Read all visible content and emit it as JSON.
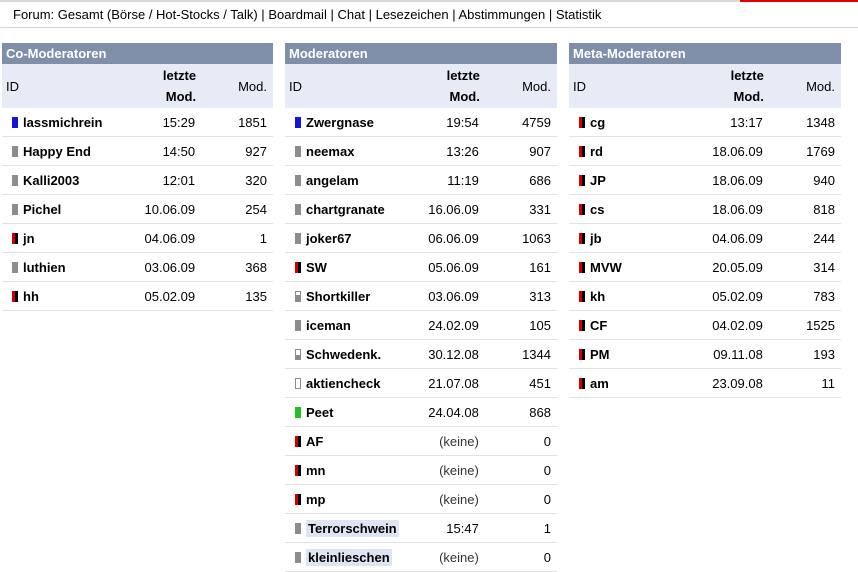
{
  "nav": {
    "prefix": "Forum:",
    "items": [
      "Gesamt (Börse / Hot-Stocks / Talk)",
      "Boardmail",
      "Chat",
      "Lesezeichen",
      "Abstimmungen",
      "Statistik"
    ],
    "separator": "|"
  },
  "colors": {
    "header_bg": "#7f8ea9",
    "subheader_bg": "#e6ebf5",
    "blue": "#1515d8",
    "grey": "#8c8c8c",
    "red": "#d00000",
    "green": "#22c022"
  },
  "panels": [
    {
      "title": "Co-Moderatoren",
      "headers": {
        "id": "ID",
        "time_line1": "letzte",
        "time_line2": "Mod.",
        "mod": "Mod."
      },
      "rows": [
        {
          "name": "lassmichrein",
          "time": "15:29",
          "mod": "1851",
          "indicator": "blue"
        },
        {
          "name": "Happy End",
          "time": "14:50",
          "mod": "927",
          "indicator": "grey"
        },
        {
          "name": "Kalli2003",
          "time": "12:01",
          "mod": "320",
          "indicator": "grey"
        },
        {
          "name": "Pichel",
          "time": "10.06.09",
          "mod": "254",
          "indicator": "grey"
        },
        {
          "name": "jn",
          "time": "04.06.09",
          "mod": "1",
          "indicator": "red-black"
        },
        {
          "name": "luthien",
          "time": "03.06.09",
          "mod": "368",
          "indicator": "grey"
        },
        {
          "name": "hh",
          "time": "05.02.09",
          "mod": "135",
          "indicator": "red-black"
        }
      ]
    },
    {
      "title": "Moderatoren",
      "headers": {
        "id": "ID",
        "time_line1": "letzte",
        "time_line2": "Mod.",
        "mod": "Mod."
      },
      "rows": [
        {
          "name": "Zwergnase",
          "time": "19:54",
          "mod": "4759",
          "indicator": "blue"
        },
        {
          "name": "neemax",
          "time": "13:26",
          "mod": "907",
          "indicator": "grey"
        },
        {
          "name": "angelam",
          "time": "11:19",
          "mod": "686",
          "indicator": "grey"
        },
        {
          "name": "chartgranate",
          "time": "16.06.09",
          "mod": "331",
          "indicator": "grey"
        },
        {
          "name": "joker67",
          "time": "06.06.09",
          "mod": "1063",
          "indicator": "grey"
        },
        {
          "name": "SW",
          "time": "05.06.09",
          "mod": "161",
          "indicator": "red-black"
        },
        {
          "name": "Shortkiller",
          "time": "03.06.09",
          "mod": "313",
          "indicator": "grey-half"
        },
        {
          "name": "iceman",
          "time": "24.02.09",
          "mod": "105",
          "indicator": "grey"
        },
        {
          "name": "Schwedenk.",
          "time": "30.12.08",
          "mod": "1344",
          "indicator": "grey-low"
        },
        {
          "name": "aktiencheck",
          "time": "21.07.08",
          "mod": "451",
          "indicator": "empty"
        },
        {
          "name": "Peet",
          "time": "24.04.08",
          "mod": "868",
          "indicator": "green"
        },
        {
          "name": "AF",
          "time": "(keine)",
          "mod": "0",
          "indicator": "red-black"
        },
        {
          "name": "mn",
          "time": "(keine)",
          "mod": "0",
          "indicator": "red-black"
        },
        {
          "name": "mp",
          "time": "(keine)",
          "mod": "0",
          "indicator": "red-black"
        },
        {
          "name": "Terrorschwein",
          "time": "15:47",
          "mod": "1",
          "indicator": "grey",
          "highlight": true
        },
        {
          "name": "kleinlieschen",
          "time": "(keine)",
          "mod": "0",
          "indicator": "grey",
          "highlight": true
        }
      ]
    },
    {
      "title": "Meta-Moderatoren",
      "headers": {
        "id": "ID",
        "time_line1": "letzte",
        "time_line2": "Mod.",
        "mod": "Mod."
      },
      "rows": [
        {
          "name": "cg",
          "time": "13:17",
          "mod": "1348",
          "indicator": "red-black"
        },
        {
          "name": "rd",
          "time": "18.06.09",
          "mod": "1769",
          "indicator": "red-black"
        },
        {
          "name": "JP",
          "time": "18.06.09",
          "mod": "940",
          "indicator": "red-black"
        },
        {
          "name": "cs",
          "time": "18.06.09",
          "mod": "818",
          "indicator": "red-black"
        },
        {
          "name": "jb",
          "time": "04.06.09",
          "mod": "244",
          "indicator": "red-black"
        },
        {
          "name": "MVW",
          "time": "20.05.09",
          "mod": "314",
          "indicator": "red-black"
        },
        {
          "name": "kh",
          "time": "05.02.09",
          "mod": "783",
          "indicator": "red-black"
        },
        {
          "name": "CF",
          "time": "04.02.09",
          "mod": "1525",
          "indicator": "red-black"
        },
        {
          "name": "PM",
          "time": "09.11.08",
          "mod": "193",
          "indicator": "red-black"
        },
        {
          "name": "am",
          "time": "23.09.08",
          "mod": "11",
          "indicator": "red-black"
        }
      ]
    }
  ]
}
